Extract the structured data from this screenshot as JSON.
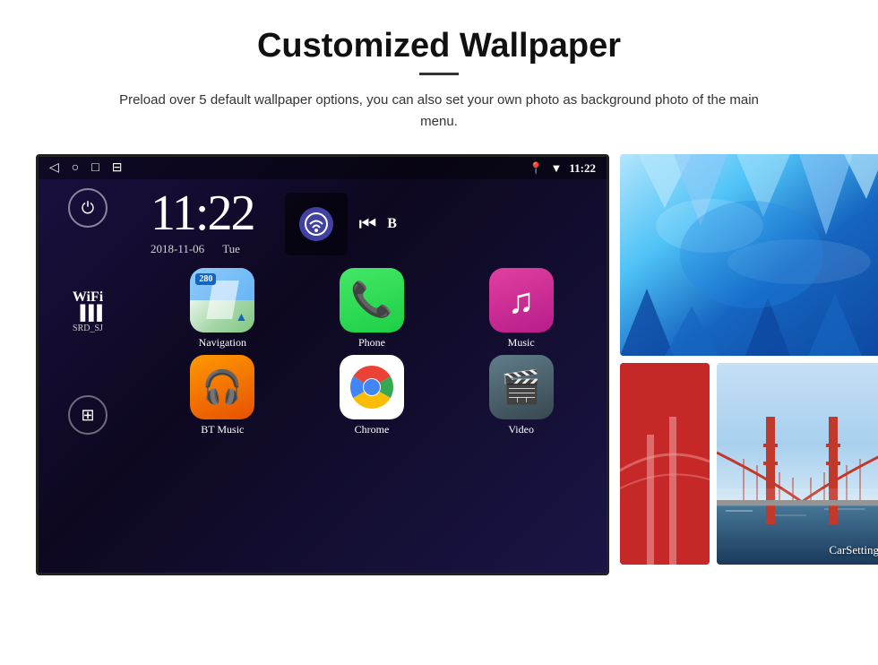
{
  "page": {
    "title": "Customized Wallpaper",
    "subtitle": "Preload over 5 default wallpaper options, you can also set your own photo as background photo of the main menu."
  },
  "status_bar": {
    "time": "11:22",
    "icons": [
      "◁",
      "○",
      "□",
      "⊟"
    ],
    "right_icons": [
      "location",
      "wifi",
      "time"
    ]
  },
  "clock": {
    "time": "11:22",
    "date": "2018-11-06",
    "day": "Tue"
  },
  "wifi": {
    "label": "WiFi",
    "ssid": "SRD_SJ"
  },
  "apps": [
    {
      "name": "Navigation",
      "type": "map",
      "label": "Navigation"
    },
    {
      "name": "Phone",
      "type": "phone",
      "label": "Phone"
    },
    {
      "name": "Music",
      "type": "music",
      "label": "Music"
    },
    {
      "name": "BT Music",
      "type": "bluetooth",
      "label": "BT Music"
    },
    {
      "name": "Chrome",
      "type": "chrome",
      "label": "Chrome"
    },
    {
      "name": "Video",
      "type": "video",
      "label": "Video"
    }
  ],
  "wallpapers": [
    {
      "name": "ice-cave",
      "label": "Ice Cave"
    },
    {
      "name": "golden-gate",
      "label": "Golden Gate"
    }
  ],
  "carsetting": {
    "label": "CarSetting"
  },
  "map_badge": "280"
}
